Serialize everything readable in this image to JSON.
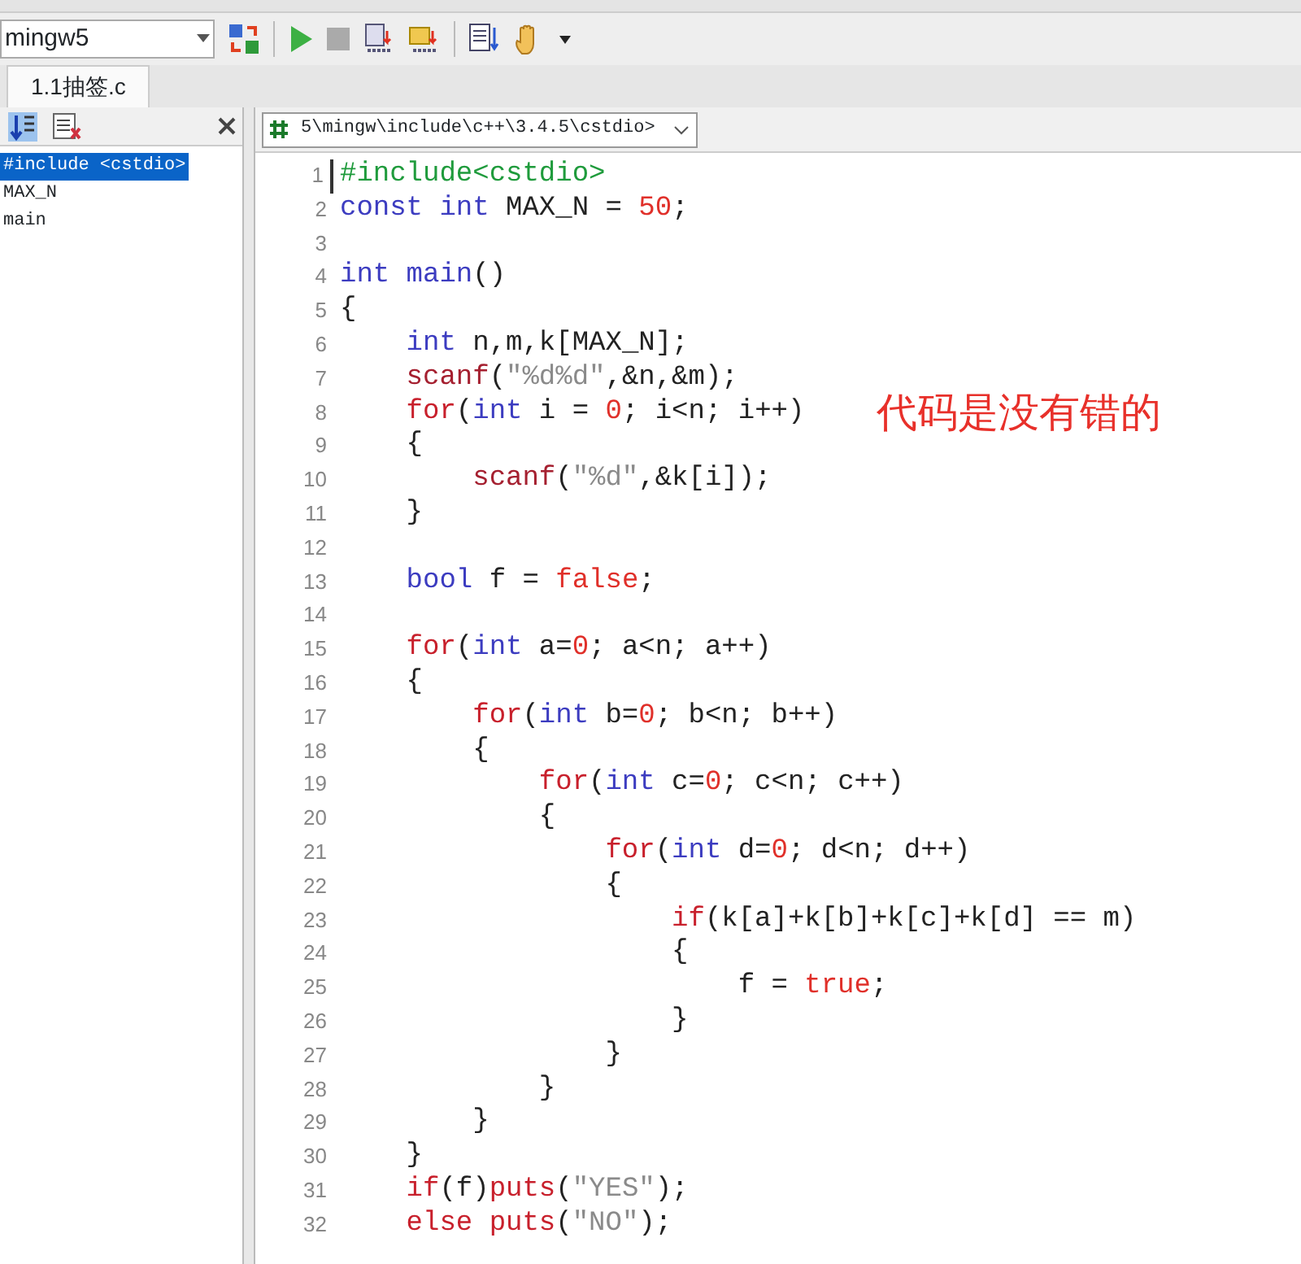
{
  "toolbar": {
    "compiler": "mingw5"
  },
  "tabs": [
    {
      "label": "1.1抽签.c",
      "selected": true
    }
  ],
  "outline": {
    "items": [
      {
        "label": "#include <cstdio>",
        "selected": true
      },
      {
        "label": "MAX_N",
        "selected": false
      },
      {
        "label": "main",
        "selected": false
      }
    ]
  },
  "editor": {
    "header": "5\\mingw\\include\\c++\\3.4.5\\cstdio>",
    "lines": [
      {
        "number": "1",
        "tokens": [
          {
            "text": "#include<cstdio>",
            "kind": "preprocessor"
          }
        ]
      },
      {
        "number": "2",
        "tokens": [
          {
            "text": "const int",
            "kind": "keyword"
          },
          {
            "text": " MAX_N = ",
            "kind": "plain"
          },
          {
            "text": "50",
            "kind": "number"
          },
          {
            "text": ";",
            "kind": "plain"
          }
        ]
      },
      {
        "number": "3"
      },
      {
        "number": "4",
        "tokens": [
          {
            "text": "int main",
            "kind": "keyword"
          },
          {
            "text": "()",
            "kind": "plain"
          }
        ]
      },
      {
        "number": "5",
        "tokens": [
          {
            "text": "{",
            "kind": "plain"
          }
        ]
      },
      {
        "number": "6",
        "tokens": [
          {
            "text": "    int",
            "kind": "keyword"
          },
          {
            "text": " n,m,k[MAX_N];",
            "kind": "plain"
          }
        ]
      },
      {
        "number": "7",
        "tokens": [
          {
            "text": "    scanf",
            "kind": "function"
          },
          {
            "text": "(",
            "kind": "plain"
          },
          {
            "text": "\"%d%d\"",
            "kind": "string"
          },
          {
            "text": ",&n,&m);",
            "kind": "plain"
          }
        ]
      },
      {
        "number": "8",
        "tokens": [
          {
            "text": "    for",
            "kind": "control"
          },
          {
            "text": "(",
            "kind": "plain"
          },
          {
            "text": "int",
            "kind": "keyword"
          },
          {
            "text": " i = ",
            "kind": "plain"
          },
          {
            "text": "0",
            "kind": "number"
          },
          {
            "text": "; i<n; i++)",
            "kind": "plain"
          }
        ]
      },
      {
        "number": "9",
        "tokens": [
          {
            "text": "    {",
            "kind": "plain"
          }
        ]
      },
      {
        "number": "10",
        "tokens": [
          {
            "text": "        scanf",
            "kind": "function"
          },
          {
            "text": "(",
            "kind": "plain"
          },
          {
            "text": "\"%d\"",
            "kind": "string"
          },
          {
            "text": ",&k[i]);",
            "kind": "plain"
          }
        ]
      },
      {
        "number": "11",
        "tokens": [
          {
            "text": "    }",
            "kind": "plain"
          }
        ]
      },
      {
        "number": "12"
      },
      {
        "number": "13",
        "tokens": [
          {
            "text": "    bool",
            "kind": "keyword"
          },
          {
            "text": " f = ",
            "kind": "plain"
          },
          {
            "text": "false",
            "kind": "number"
          },
          {
            "text": ";",
            "kind": "plain"
          }
        ]
      },
      {
        "number": "14"
      },
      {
        "number": "15",
        "tokens": [
          {
            "text": "    for",
            "kind": "control"
          },
          {
            "text": "(",
            "kind": "plain"
          },
          {
            "text": "int",
            "kind": "keyword"
          },
          {
            "text": " a=",
            "kind": "plain"
          },
          {
            "text": "0",
            "kind": "number"
          },
          {
            "text": "; a<n; a++)",
            "kind": "plain"
          }
        ]
      },
      {
        "number": "16",
        "tokens": [
          {
            "text": "    {",
            "kind": "plain"
          }
        ]
      },
      {
        "number": "17",
        "tokens": [
          {
            "text": "        for",
            "kind": "control"
          },
          {
            "text": "(",
            "kind": "plain"
          },
          {
            "text": "int",
            "kind": "keyword"
          },
          {
            "text": " b=",
            "kind": "plain"
          },
          {
            "text": "0",
            "kind": "number"
          },
          {
            "text": "; b<n; b++)",
            "kind": "plain"
          }
        ]
      },
      {
        "number": "18",
        "tokens": [
          {
            "text": "        {",
            "kind": "plain"
          }
        ]
      },
      {
        "number": "19",
        "tokens": [
          {
            "text": "            for",
            "kind": "control"
          },
          {
            "text": "(",
            "kind": "plain"
          },
          {
            "text": "int",
            "kind": "keyword"
          },
          {
            "text": " c=",
            "kind": "plain"
          },
          {
            "text": "0",
            "kind": "number"
          },
          {
            "text": "; c<n; c++)",
            "kind": "plain"
          }
        ]
      },
      {
        "number": "20",
        "tokens": [
          {
            "text": "            {",
            "kind": "plain"
          }
        ]
      },
      {
        "number": "21",
        "tokens": [
          {
            "text": "                for",
            "kind": "control"
          },
          {
            "text": "(",
            "kind": "plain"
          },
          {
            "text": "int",
            "kind": "keyword"
          },
          {
            "text": " d=",
            "kind": "plain"
          },
          {
            "text": "0",
            "kind": "number"
          },
          {
            "text": "; d<n; d++)",
            "kind": "plain"
          }
        ]
      },
      {
        "number": "22",
        "tokens": [
          {
            "text": "                {",
            "kind": "plain"
          }
        ]
      },
      {
        "number": "23",
        "tokens": [
          {
            "text": "                    if",
            "kind": "control"
          },
          {
            "text": "(k[a]+k[b]+k[c]+k[d] == m)",
            "kind": "plain"
          }
        ]
      },
      {
        "number": "24",
        "tokens": [
          {
            "text": "                    {",
            "kind": "plain"
          }
        ]
      },
      {
        "number": "25",
        "tokens": [
          {
            "text": "                        f = ",
            "kind": "plain"
          },
          {
            "text": "true",
            "kind": "number"
          },
          {
            "text": ";",
            "kind": "plain"
          }
        ]
      },
      {
        "number": "26",
        "tokens": [
          {
            "text": "                    }",
            "kind": "plain"
          }
        ]
      },
      {
        "number": "27",
        "tokens": [
          {
            "text": "                }",
            "kind": "plain"
          }
        ]
      },
      {
        "number": "28",
        "tokens": [
          {
            "text": "            }",
            "kind": "plain"
          }
        ]
      },
      {
        "number": "29",
        "tokens": [
          {
            "text": "        }",
            "kind": "plain"
          }
        ]
      },
      {
        "number": "30",
        "tokens": [
          {
            "text": "    }",
            "kind": "plain"
          }
        ]
      },
      {
        "number": "31",
        "tokens": [
          {
            "text": "    if",
            "kind": "control"
          },
          {
            "text": "(f)",
            "kind": "plain"
          },
          {
            "text": "puts",
            "kind": "control"
          },
          {
            "text": "(",
            "kind": "plain"
          },
          {
            "text": "\"YES\"",
            "kind": "string"
          },
          {
            "text": ");",
            "kind": "plain"
          }
        ]
      },
      {
        "number": "32",
        "tokens": [
          {
            "text": "    else",
            "kind": "control"
          },
          {
            "text": " puts",
            "kind": "control"
          },
          {
            "text": "(",
            "kind": "plain"
          },
          {
            "text": "\"NO\"",
            "kind": "string"
          },
          {
            "text": ");",
            "kind": "plain"
          }
        ]
      }
    ]
  },
  "annotation": "代码是没有错的"
}
